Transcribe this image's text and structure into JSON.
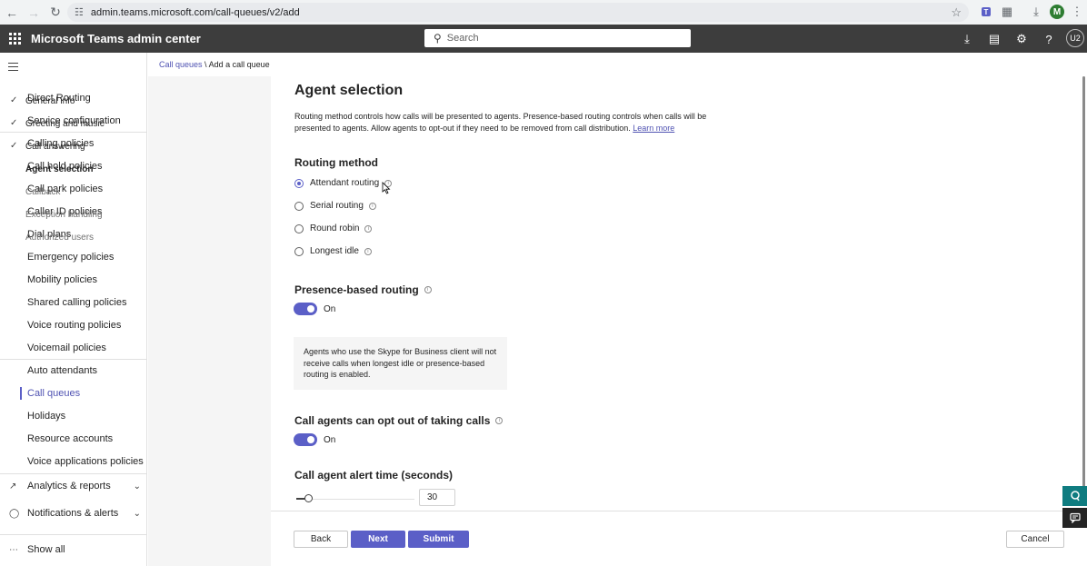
{
  "browser": {
    "url": "admin.teams.microsoft.com/call-queues/v2/add",
    "profile_initial": "M"
  },
  "header": {
    "title": "Microsoft Teams admin center",
    "search_placeholder": "Search",
    "user_initials": "U2"
  },
  "leftnav": {
    "items": [
      "Direct Routing",
      "Service configuration",
      "Calling policies",
      "Call hold policies",
      "Call park policies",
      "Caller ID policies",
      "Dial plans",
      "Emergency policies",
      "Mobility policies",
      "Shared calling policies",
      "Voice routing policies",
      "Voicemail policies",
      "Auto attendants",
      "Call queues",
      "Holidays",
      "Resource accounts",
      "Voice applications policies"
    ],
    "active": "Call queues",
    "groups": [
      "Analytics & reports",
      "Notifications & alerts"
    ],
    "show_all": "Show all"
  },
  "breadcrumb": {
    "parent": "Call queues",
    "separator": "\\",
    "current": "Add a call queue"
  },
  "steps": [
    {
      "label": "General info",
      "state": "done"
    },
    {
      "label": "Greeting and music",
      "state": "done"
    },
    {
      "label": "Call answering",
      "state": "done"
    },
    {
      "label": "Agent selection",
      "state": "current"
    },
    {
      "label": "Callback",
      "state": "pending"
    },
    {
      "label": "Exception handling",
      "state": "pending"
    },
    {
      "label": "Authorized users",
      "state": "pending"
    }
  ],
  "main": {
    "title": "Agent selection",
    "description": "Routing method controls how calls will be presented to agents. Presence-based routing controls when calls will be presented to agents. Allow agents to opt-out if they need to be removed from call distribution.",
    "learn_more": "Learn more",
    "routing_method": {
      "heading": "Routing method",
      "options": [
        "Attendant routing",
        "Serial routing",
        "Round robin",
        "Longest idle"
      ],
      "selected": "Attendant routing"
    },
    "presence": {
      "heading": "Presence-based routing",
      "toggle_label": "On",
      "toggle_on": true,
      "notice": "Agents who use the Skype for Business client will not receive calls when longest idle or presence-based routing is enabled."
    },
    "opt_out": {
      "heading": "Call agents can opt out of taking calls",
      "toggle_label": "On",
      "toggle_on": true
    },
    "alert_time": {
      "heading": "Call agent alert time (seconds)",
      "value": "30"
    }
  },
  "footer": {
    "back": "Back",
    "next": "Next",
    "submit": "Submit",
    "cancel": "Cancel"
  },
  "colors": {
    "accent": "#5b5fc7",
    "header_bg": "#3d3d3d",
    "fab": "#0f7c80"
  }
}
